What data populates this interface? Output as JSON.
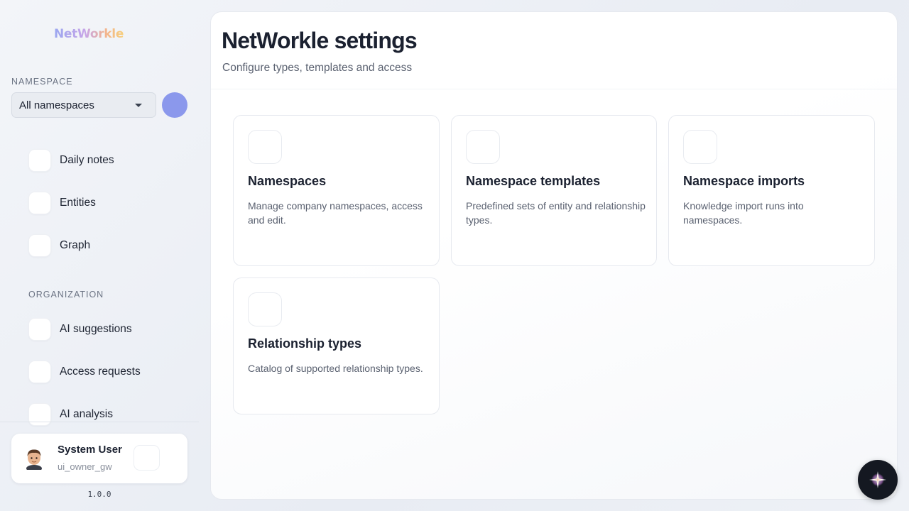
{
  "app": {
    "logo_text": "NetWorkle",
    "version": "1.0.0"
  },
  "sidebar": {
    "namespace_label": "NAMESPACE",
    "namespace_selected": "All namespaces",
    "items": [
      {
        "label": "Daily notes"
      },
      {
        "label": "Entities"
      },
      {
        "label": "Graph"
      }
    ],
    "org_label": "ORGANIZATION",
    "org_items": [
      {
        "label": "AI suggestions"
      },
      {
        "label": "Access requests"
      },
      {
        "label": "AI analysis"
      }
    ]
  },
  "user": {
    "name": "System User",
    "id": "ui_owner_gw"
  },
  "main": {
    "title": "NetWorkle settings",
    "subtitle": "Configure types, templates and access",
    "cards": [
      {
        "title": "Namespaces",
        "description": "Manage company namespaces, access and edit."
      },
      {
        "title": "Namespace templates",
        "description": "Predefined sets of entity and relationship types."
      },
      {
        "title": "Namespace imports",
        "description": "Knowledge import runs into namespaces."
      },
      {
        "title": "Relationship types",
        "description": "Catalog of supported relationship types."
      }
    ]
  },
  "colors": {
    "accent_dot": "#8b98ec",
    "fab_background": "#141821"
  }
}
